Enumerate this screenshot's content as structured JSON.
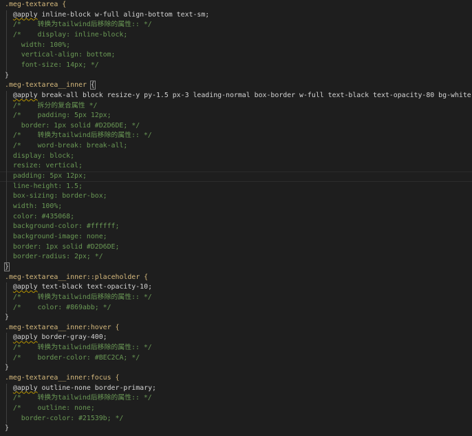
{
  "editor": {
    "lines": [
      {
        "indent": 0,
        "kind": "sel",
        "text": ".meg-textarea {"
      },
      {
        "indent": 2,
        "kind": "at",
        "kw": "@apply",
        "text": " inline-block w-full align-bottom text-sm;"
      },
      {
        "indent": 2,
        "kind": "cm",
        "text": "/*    转换为tailwind后移除的属性:: */"
      },
      {
        "indent": 2,
        "kind": "cm",
        "text": "/*    display: inline-block;"
      },
      {
        "indent": 4,
        "kind": "cm",
        "text": "width: 100%;"
      },
      {
        "indent": 4,
        "kind": "cm",
        "text": "vertical-align: bottom;"
      },
      {
        "indent": 4,
        "kind": "cm",
        "text": "font-size: 14px; */"
      },
      {
        "indent": 0,
        "kind": "br",
        "text": "}"
      },
      {
        "indent": 0,
        "kind": "sel",
        "text": ".meg-textarea__inner ",
        "brace": "{"
      },
      {
        "indent": 2,
        "kind": "at",
        "kw": "@apply",
        "text": " break-all block resize-y py-1.5 px-3 leading-normal box-border w-full text-black text-opacity-80 bg-white"
      },
      {
        "indent": 2,
        "kind": "cm",
        "text": "/*    拆分的复合属性 */"
      },
      {
        "indent": 2,
        "kind": "cm",
        "text": "/*    padding: 5px 12px;"
      },
      {
        "indent": 4,
        "kind": "cm",
        "text": "border: 1px solid #D2D6DE; */"
      },
      {
        "indent": 2,
        "kind": "cm",
        "text": "/*    转换为tailwind后移除的属性:: */"
      },
      {
        "indent": 2,
        "kind": "cm",
        "text": "/*    word-break: break-all;"
      },
      {
        "indent": 2,
        "kind": "cm",
        "text": "display: block;"
      },
      {
        "indent": 2,
        "kind": "cm",
        "text": "resize: vertical;"
      },
      {
        "indent": 2,
        "kind": "cm",
        "text": "padding: 5px 12px;",
        "current": true
      },
      {
        "indent": 2,
        "kind": "cm",
        "text": "line-height: 1.5;"
      },
      {
        "indent": 2,
        "kind": "cm",
        "text": "box-sizing: border-box;"
      },
      {
        "indent": 2,
        "kind": "cm",
        "text": "width: 100%;"
      },
      {
        "indent": 2,
        "kind": "cm",
        "text": "color: #435068;"
      },
      {
        "indent": 2,
        "kind": "cm",
        "text": "background-color: #ffffff;"
      },
      {
        "indent": 2,
        "kind": "cm",
        "text": "background-image: none;"
      },
      {
        "indent": 2,
        "kind": "cm",
        "text": "border: 1px solid #D2D6DE;"
      },
      {
        "indent": 2,
        "kind": "cm",
        "text": "border-radius: 2px; */"
      },
      {
        "indent": 0,
        "kind": "br",
        "text": "}",
        "match": true
      },
      {
        "indent": 0,
        "kind": "sel",
        "text": ".meg-textarea__inner::placeholder {"
      },
      {
        "indent": 2,
        "kind": "at",
        "kw": "@apply",
        "text": " text-black text-opacity-10;"
      },
      {
        "indent": 2,
        "kind": "cm",
        "text": "/*    转换为tailwind后移除的属性:: */"
      },
      {
        "indent": 2,
        "kind": "cm",
        "text": "/*    color: #869abb; */"
      },
      {
        "indent": 0,
        "kind": "br",
        "text": "}"
      },
      {
        "indent": 0,
        "kind": "sel",
        "text": ".meg-textarea__inner:hover {"
      },
      {
        "indent": 2,
        "kind": "at",
        "kw": "@apply",
        "text": " border-gray-400;"
      },
      {
        "indent": 2,
        "kind": "cm",
        "text": "/*    转换为tailwind后移除的属性:: */"
      },
      {
        "indent": 2,
        "kind": "cm",
        "text": "/*    border-color: #BEC2CA; */"
      },
      {
        "indent": 0,
        "kind": "br",
        "text": "}"
      },
      {
        "indent": 0,
        "kind": "sel",
        "text": ".meg-textarea__inner:focus {"
      },
      {
        "indent": 2,
        "kind": "at",
        "kw": "@apply",
        "text": " outline-none border-primary;"
      },
      {
        "indent": 2,
        "kind": "cm",
        "text": "/*    转换为tailwind后移除的属性:: */"
      },
      {
        "indent": 2,
        "kind": "cm",
        "text": "/*    outline: none;"
      },
      {
        "indent": 4,
        "kind": "cm",
        "text": "border-color: #21539b; */"
      },
      {
        "indent": 0,
        "kind": "br",
        "text": "}"
      }
    ]
  }
}
